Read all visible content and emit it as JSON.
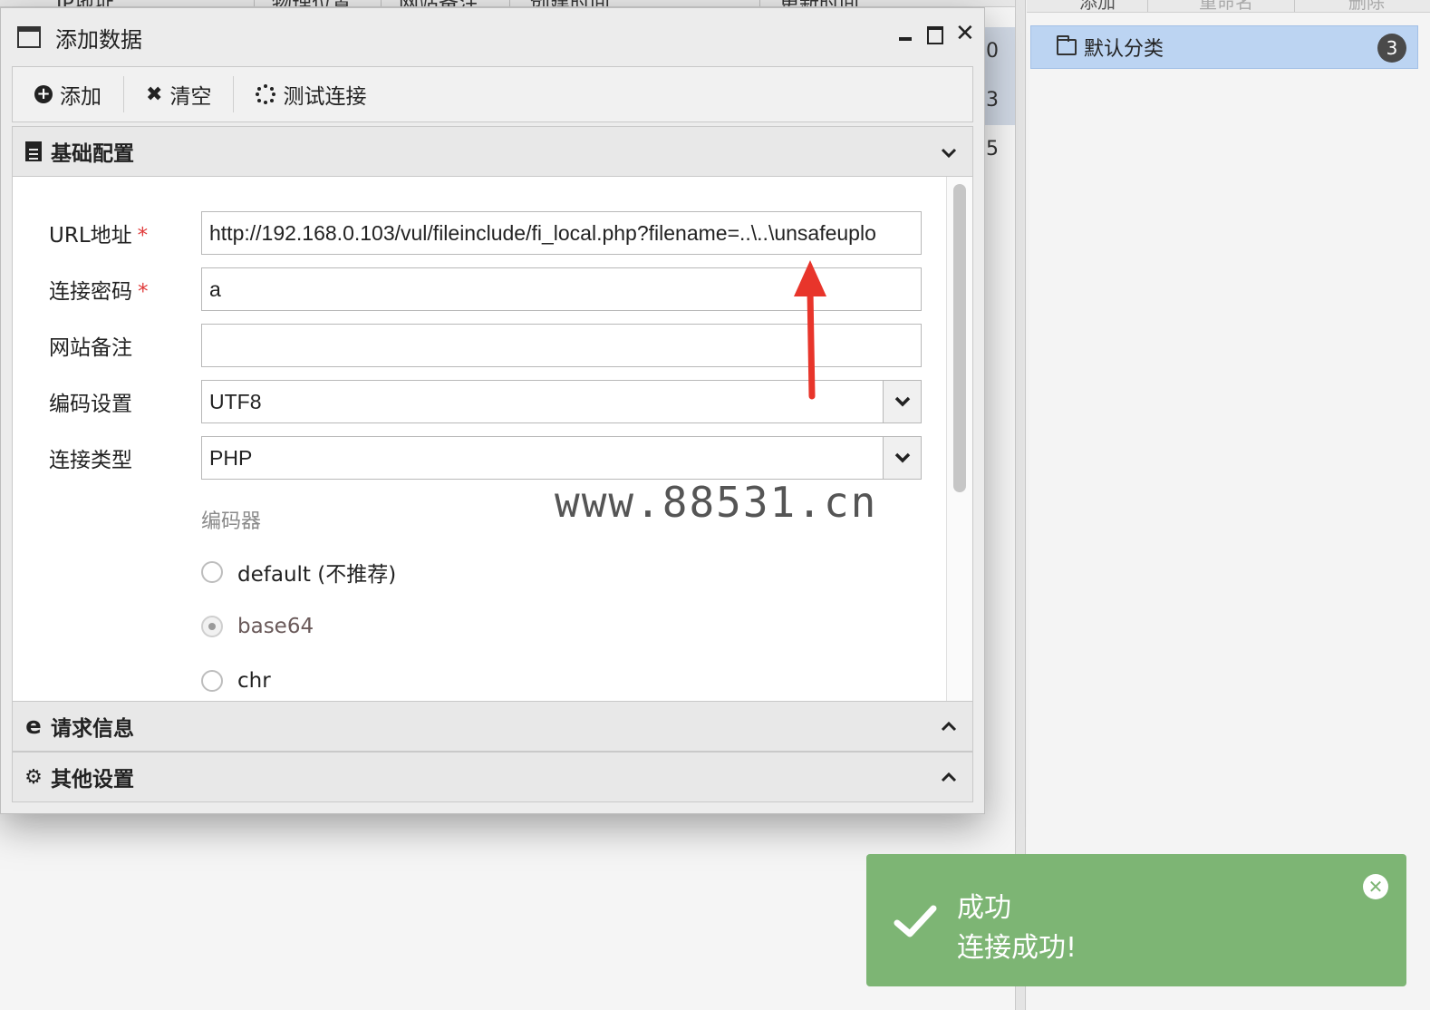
{
  "background": {
    "header_columns": [
      "IP地址",
      "物理位置",
      "网站备注",
      "创建时间",
      "更新时间"
    ],
    "row_cells": [
      "0",
      "3",
      "5"
    ],
    "right_toolbar": [
      "添加",
      "重命名",
      "删除"
    ],
    "category": {
      "label": "默认分类",
      "count": "3"
    }
  },
  "dialog": {
    "title": "添加数据",
    "toolbar": {
      "add": "添加",
      "clear": "清空",
      "test": "测试连接"
    },
    "panels": {
      "basic": "基础配置",
      "request": "请求信息",
      "other": "其他设置"
    },
    "form": {
      "url_label": "URL地址",
      "url_value": "http://192.168.0.103/vul/fileinclude/fi_local.php?filename=..\\..\\unsafeuplo",
      "password_label": "连接密码",
      "password_value": "a",
      "note_label": "网站备注",
      "note_value": "",
      "encoding_label": "编码设置",
      "encoding_value": "UTF8",
      "type_label": "连接类型",
      "type_value": "PHP",
      "required_mark": "*"
    },
    "encoder": {
      "title": "编码器",
      "options": [
        "default (不推荐)",
        "base64",
        "chr"
      ],
      "selected": "base64"
    }
  },
  "watermark": "www.88531.cn",
  "toast": {
    "title": "成功",
    "message": "连接成功!"
  },
  "colors": {
    "toast_bg": "#7db574",
    "arrow": "#e8352b",
    "selection": "#bcd4f2"
  }
}
